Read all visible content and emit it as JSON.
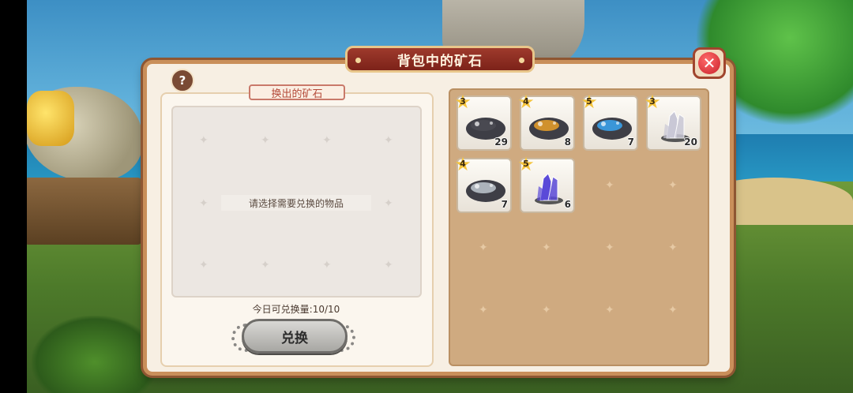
{
  "title": "背包中的矿石",
  "close_icon": "close-icon",
  "help_label": "?",
  "left": {
    "tag": "换出的矿石",
    "placeholder": "请选择需要兑换的物品",
    "daily_limit": "今日可兑换量:10/10",
    "button_label": "兑换"
  },
  "inventory": {
    "items": [
      {
        "name": "dark-ore",
        "stars": "3",
        "count": "29",
        "color": "#4a4a52"
      },
      {
        "name": "gold-ore",
        "stars": "4",
        "count": "8",
        "color": "#e09a2a"
      },
      {
        "name": "rainbow-ore",
        "stars": "5",
        "count": "7",
        "color": "#3aa0e8"
      },
      {
        "name": "quartz-crystal",
        "stars": "3",
        "count": "20",
        "color": "#c9c8d6"
      },
      {
        "name": "opal-stone",
        "stars": "4",
        "count": "7",
        "color": "#b8c0c8"
      },
      {
        "name": "amethyst-crystal",
        "stars": "5",
        "count": "6",
        "color": "#5a4ad8"
      }
    ]
  }
}
